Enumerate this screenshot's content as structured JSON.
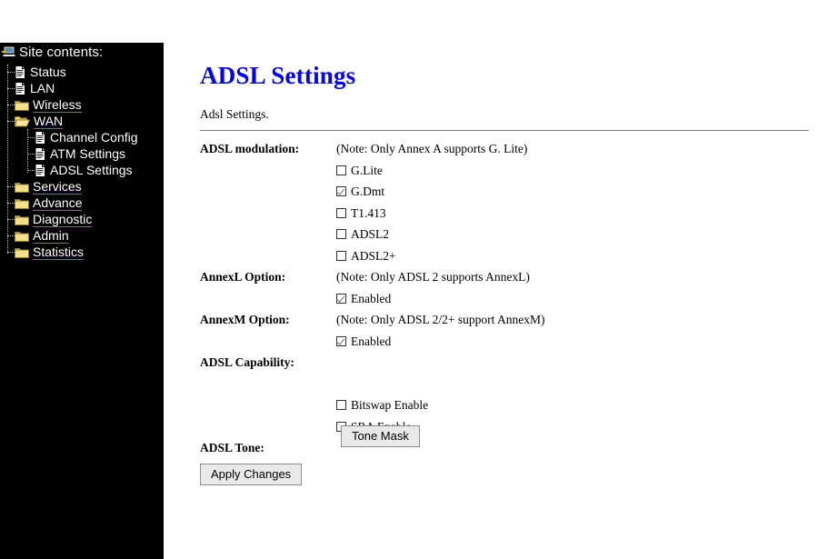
{
  "sidebar": {
    "root": {
      "label": "Site contents:",
      "icon": "computer-icon"
    },
    "items": [
      {
        "label": "Status",
        "icon": "page-icon",
        "indent": 1,
        "link": false
      },
      {
        "label": "LAN",
        "icon": "page-icon",
        "indent": 1,
        "link": false
      },
      {
        "label": "Wireless",
        "icon": "folder-icon",
        "indent": 1,
        "link": true
      },
      {
        "label": "WAN",
        "icon": "folder-open-icon",
        "indent": 1,
        "link": true
      },
      {
        "label": "Channel Config",
        "icon": "page-icon",
        "indent": 2,
        "link": false
      },
      {
        "label": "ATM Settings",
        "icon": "page-icon",
        "indent": 2,
        "link": false
      },
      {
        "label": "ADSL Settings",
        "icon": "page-icon",
        "indent": 2,
        "link": false
      },
      {
        "label": "Services",
        "icon": "folder-icon",
        "indent": 1,
        "link": true
      },
      {
        "label": "Advance",
        "icon": "folder-icon",
        "indent": 1,
        "link": true
      },
      {
        "label": "Diagnostic",
        "icon": "folder-icon",
        "indent": 1,
        "link": true
      },
      {
        "label": "Admin",
        "icon": "folder-icon",
        "indent": 1,
        "link": true
      },
      {
        "label": "Statistics",
        "icon": "folder-icon",
        "indent": 1,
        "link": true
      }
    ],
    "colors": {
      "background": "#000000",
      "text": "#ffffff",
      "link_underline": "#a14ba1"
    }
  },
  "page": {
    "title": "ADSL Settings",
    "title_color": "#0000ee",
    "subtitle": "Adsl Settings."
  },
  "form": {
    "modulation": {
      "label": "ADSL modulation:",
      "note": "(Note: Only Annex A supports G. Lite)",
      "options": [
        {
          "label": "G.Lite",
          "checked": false
        },
        {
          "label": "G.Dmt",
          "checked": true
        },
        {
          "label": "T1.413",
          "checked": false
        },
        {
          "label": "ADSL2",
          "checked": false
        },
        {
          "label": "ADSL2+",
          "checked": false
        }
      ]
    },
    "annexl": {
      "label": "AnnexL Option:",
      "note": "(Note: Only ADSL 2 supports AnnexL)",
      "options": [
        {
          "label": "Enabled",
          "checked": true
        }
      ]
    },
    "annexm": {
      "label": "AnnexM Option:",
      "note": "(Note: Only ADSL 2/2+ support AnnexM)",
      "options": [
        {
          "label": "Enabled",
          "checked": true
        }
      ]
    },
    "capability": {
      "label": "ADSL Capability:",
      "options": [
        {
          "label": "Bitswap Enable",
          "checked": false
        },
        {
          "label": "SRA Enable",
          "checked": false
        }
      ]
    },
    "tone": {
      "label": "ADSL Tone:",
      "button": "Tone Mask"
    },
    "apply_button": "Apply Changes"
  }
}
